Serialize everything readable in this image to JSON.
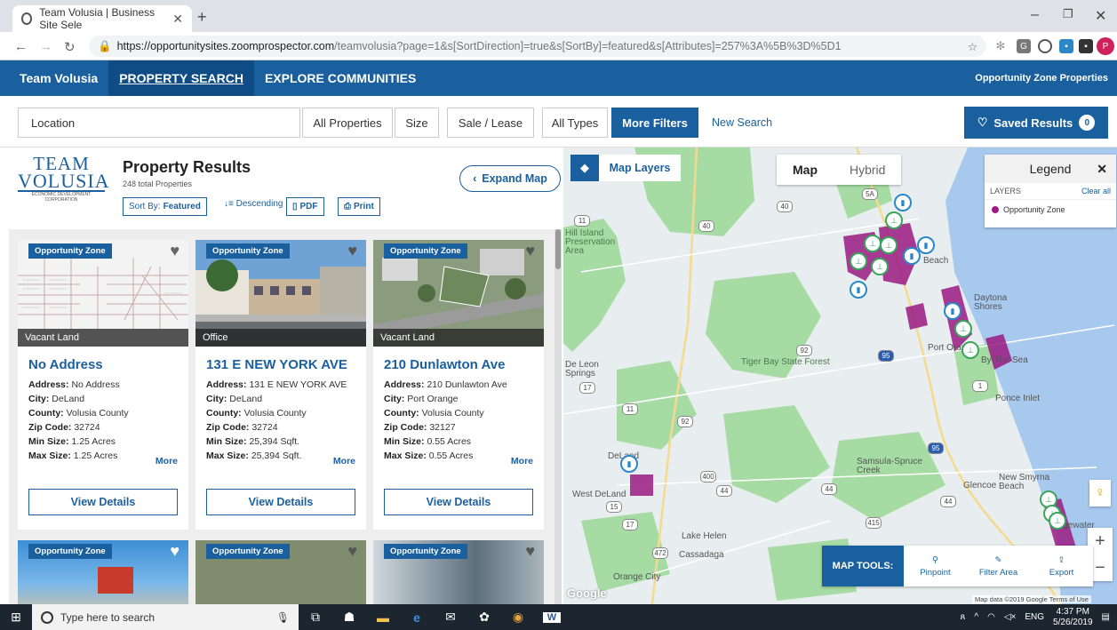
{
  "browser": {
    "tab_title": "Team Volusia | Business Site Sele",
    "url_host": "https://opportunitysites.zoomprospector.com",
    "url_path": "/teamvolusia?page=1&s[SortDirection]=true&s[SortBy]=featured&s[Attributes]=257%3A%5B%3D%5D1",
    "avatar_letter": "P"
  },
  "site_nav": {
    "brand": "Team Volusia",
    "items": [
      "PROPERTY SEARCH",
      "EXPLORE COMMUNITIES"
    ],
    "right_link": "Opportunity Zone Properties"
  },
  "filters": {
    "location_placeholder": "Location",
    "buttons": [
      "All Properties",
      "Size",
      "Sale / Lease",
      "All Types",
      "More Filters"
    ],
    "new_search": "New Search",
    "saved_results": "Saved Results",
    "saved_count": "0"
  },
  "results": {
    "logo_text": "TEAM",
    "logo_text2": "VOLUSIA",
    "logo_sub": "ECONOMIC DEVELOPMENT CORPORATION",
    "title": "Property Results",
    "count": "248 total Properties",
    "sort_label": "Sort By:",
    "sort_value": "Featured",
    "direction": "Descending",
    "pdf": "PDF",
    "print": "Print",
    "expand_map": "Expand Map"
  },
  "cards": [
    {
      "badge": "Opportunity Zone",
      "type": "Vacant Land",
      "title": "No Address",
      "address": "No Address",
      "city": "DeLand",
      "county": "Volusia County",
      "zip": "32724",
      "min": "1.25 Acres",
      "max": "1.25 Acres",
      "more": "More",
      "btn": "View Details"
    },
    {
      "badge": "Opportunity Zone",
      "type": "Office",
      "title": "131 E NEW YORK AVE",
      "address": "131 E NEW YORK AVE",
      "city": "DeLand",
      "county": "Volusia County",
      "zip": "32724",
      "min": "25,394 Sqft.",
      "max": "25,394 Sqft.",
      "more": "More",
      "btn": "View Details"
    },
    {
      "badge": "Opportunity Zone",
      "type": "Vacant Land",
      "title": "210 Dunlawton Ave",
      "address": "210 Dunlawton Ave",
      "city": "Port Orange",
      "county": "Volusia County",
      "zip": "32127",
      "min": "0.55 Acres",
      "max": "0.55 Acres",
      "more": "More",
      "btn": "View Details"
    }
  ],
  "card_labels": {
    "address": "Address:",
    "city": "City:",
    "county": "County:",
    "zip": "Zip Code:",
    "min": "Min Size:",
    "max": "Max Size:"
  },
  "row2_badges": [
    "Opportunity Zone",
    "Opportunity Zone",
    "Opportunity Zone"
  ],
  "map": {
    "layers_btn": "Map Layers",
    "type_map": "Map",
    "type_hybrid": "Hybrid",
    "legend_title": "Legend",
    "legend_layers": "LAYERS",
    "legend_clear": "Clear all",
    "legend_item": "Opportunity Zone",
    "tools_label": "MAP TOOLS:",
    "tools": [
      "Pinpoint",
      "Filter Area",
      "Export"
    ],
    "attribution": "Map data ©2019 Google   Terms of Use",
    "google": "Google",
    "places": [
      "Tiger Bay State Forest",
      "Port Orange",
      "By-The Sea",
      "Ponce Inlet",
      "Samsula-Spruce Creek",
      "Glencoe",
      "New Smyrna Beach",
      "Lake Helen",
      "Cassadaga",
      "Orange City",
      "West DeLand",
      "DeLand",
      "De Leon Springs",
      "Daytona Shores",
      "Beach",
      "Edgewater",
      "Hill Island Preservation Area"
    ],
    "routes": [
      "11",
      "40",
      "40",
      "5A",
      "92",
      "95",
      "17",
      "11",
      "92",
      "400",
      "44",
      "44",
      "15",
      "17",
      "415",
      "472",
      "44",
      "95",
      "1"
    ],
    "opportunity_zone_color": "#9b1b82"
  },
  "taskbar": {
    "search_placeholder": "Type here to search",
    "lang": "ENG",
    "time": "4:37 PM",
    "date": "5/26/2019"
  }
}
